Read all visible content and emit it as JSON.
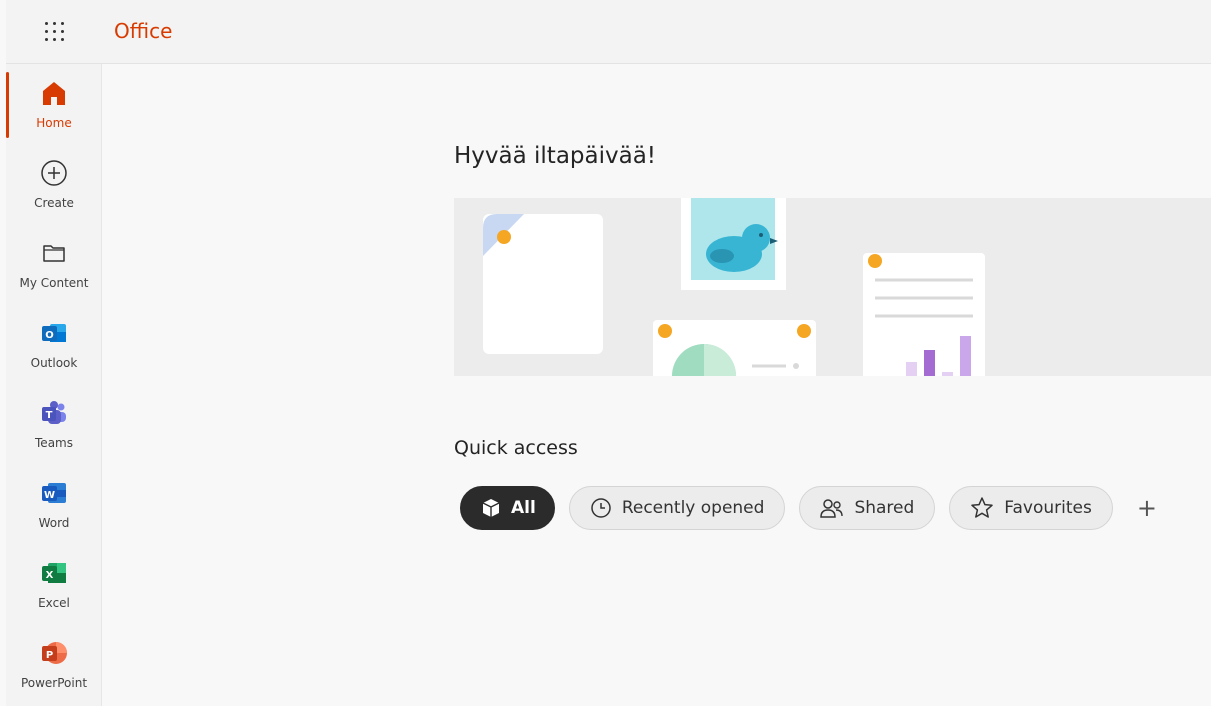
{
  "header": {
    "brand": "Office"
  },
  "rail": {
    "items": [
      {
        "label": "Home",
        "icon": "home-icon"
      },
      {
        "label": "Create",
        "icon": "plus-circle-icon"
      },
      {
        "label": "My Content",
        "icon": "folder-icon"
      },
      {
        "label": "Outlook",
        "icon": "outlook-icon"
      },
      {
        "label": "Teams",
        "icon": "teams-icon"
      },
      {
        "label": "Word",
        "icon": "word-icon"
      },
      {
        "label": "Excel",
        "icon": "excel-icon"
      },
      {
        "label": "PowerPoint",
        "icon": "powerpoint-icon"
      }
    ]
  },
  "main": {
    "greeting": "Hyvää iltapäivää!",
    "quick_access": {
      "title": "Quick access",
      "filters": [
        {
          "label": "All",
          "icon": "cube-icon",
          "selected": true
        },
        {
          "label": "Recently opened",
          "icon": "clock-icon",
          "selected": false
        },
        {
          "label": "Shared",
          "icon": "people-icon",
          "selected": false
        },
        {
          "label": "Favourites",
          "icon": "star-icon",
          "selected": false
        }
      ],
      "add_label": "+"
    }
  },
  "colors": {
    "accent": "#d83b01",
    "outlook": "#0f6cbd",
    "teams": "#5b5fc7",
    "word": "#185abd",
    "excel": "#107c41",
    "powerpoint": "#c43e1c"
  }
}
